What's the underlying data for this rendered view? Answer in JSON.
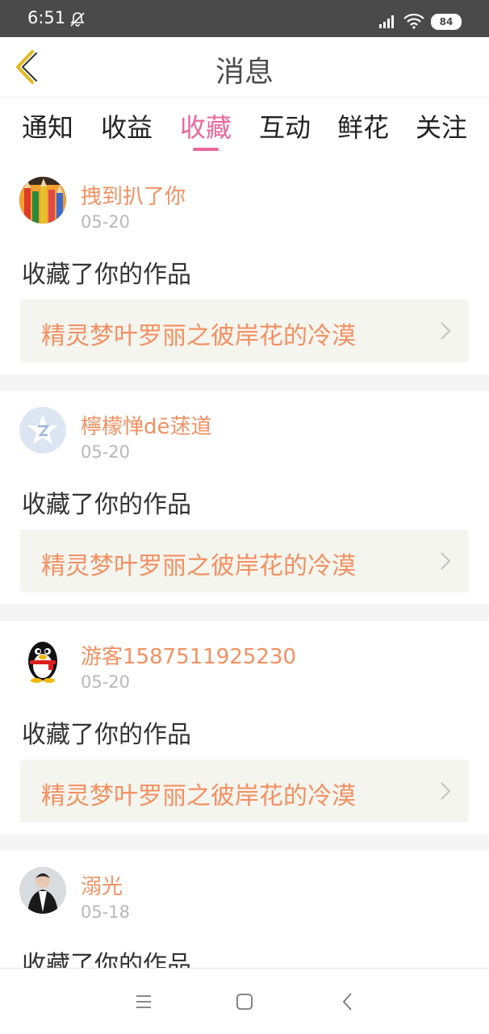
{
  "status_bar": {
    "time": "6:51",
    "battery": "84"
  },
  "header": {
    "title": "消息"
  },
  "tabs": [
    {
      "label": "通知"
    },
    {
      "label": "收益"
    },
    {
      "label": "收藏",
      "active": true
    },
    {
      "label": "互动"
    },
    {
      "label": "鲜花"
    },
    {
      "label": "关注"
    }
  ],
  "messages": [
    {
      "username": "拽到扒了你",
      "date": "05-20",
      "action": "收藏了你的作品",
      "work_title": "精灵梦叶罗丽之彼岸花的冷漠",
      "avatar": "pencils-avatar"
    },
    {
      "username": "檸檬惮dē蒁道",
      "date": "05-20",
      "action": "收藏了你的作品",
      "work_title": "精灵梦叶罗丽之彼岸花的冷漠",
      "avatar": "default-star-avatar"
    },
    {
      "username": "游客1587511925230",
      "date": "05-20",
      "action": "收藏了你的作品",
      "work_title": "精灵梦叶罗丽之彼岸花的冷漠",
      "avatar": "qq-penguin-avatar"
    },
    {
      "username": "溺光",
      "date": "05-18",
      "action": "收藏了你的作品",
      "avatar": "person-avatar"
    }
  ],
  "colors": {
    "accent": "#e8699c",
    "orange_text": "#f39060",
    "back_icon": "#e3b81e"
  }
}
